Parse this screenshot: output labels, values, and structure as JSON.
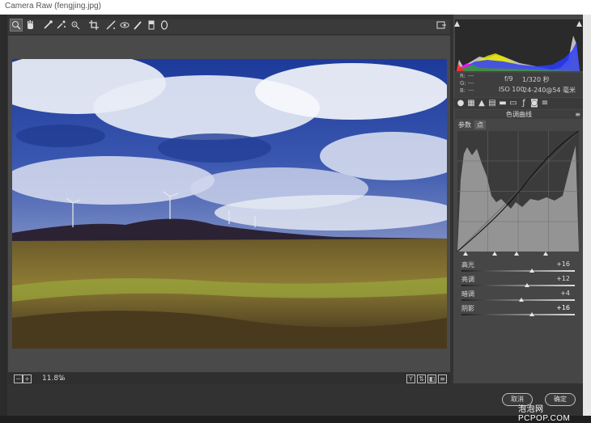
{
  "window": {
    "title": "Camera Raw (fengjing.jpg)"
  },
  "toolbar": {
    "tools": [
      {
        "name": "zoom-tool",
        "glyph": "🔍"
      },
      {
        "name": "hand-tool",
        "glyph": "✋"
      },
      {
        "name": "white-balance-tool",
        "glyph": "✎"
      },
      {
        "name": "color-sampler-tool",
        "glyph": "✎"
      },
      {
        "name": "targeted-adjustment-tool",
        "glyph": "◎"
      },
      {
        "name": "crop-tool",
        "glyph": "⌗"
      },
      {
        "name": "straighten-tool",
        "glyph": "✎"
      },
      {
        "name": "red-eye-tool",
        "glyph": "◉"
      },
      {
        "name": "adjustment-brush-tool",
        "glyph": "✎"
      },
      {
        "name": "graduated-filter-tool",
        "glyph": "▮"
      },
      {
        "name": "radial-filter-tool",
        "glyph": "◯"
      }
    ]
  },
  "bottombar": {
    "zoom_value": "11.8%",
    "zoom_arrow": "⌄"
  },
  "histogram": {
    "colors": {
      "blue": "#2a3cff",
      "yellow": "#e6e600",
      "gray": "#bdbdbd",
      "magenta": "#ff00ff",
      "green": "#00c000",
      "red": "#ff2020"
    }
  },
  "camera_info": {
    "r_label": "R:",
    "g_label": "G:",
    "b_label": "B:",
    "dash": "---",
    "aperture": "f/9",
    "shutter": "1/320 秒",
    "iso": "ISO 100",
    "lens": "24-240@54 毫米"
  },
  "panel": {
    "title": "色调曲线",
    "tabs": [
      {
        "label": "参数"
      },
      {
        "label": "点"
      }
    ]
  },
  "curve": {
    "sliders": [
      {
        "label": "高光",
        "value": "+16",
        "position": 0.62
      },
      {
        "label": "亮调",
        "value": "+12",
        "position": 0.58
      },
      {
        "label": "暗调",
        "value": "+4",
        "position": 0.53
      },
      {
        "label": "阴影",
        "value": "+16",
        "position": 0.62
      }
    ]
  },
  "buttons": {
    "cancel": "取消",
    "ok": "确定"
  },
  "watermark": "泡泡网  PCPOP.COM"
}
